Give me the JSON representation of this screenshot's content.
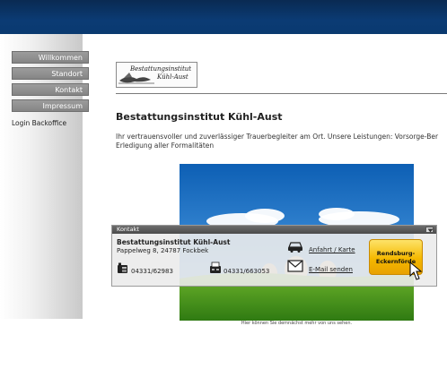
{
  "nav": {
    "items": [
      {
        "label": "Willkommen"
      },
      {
        "label": "Standort"
      },
      {
        "label": "Kontakt"
      },
      {
        "label": "Impressum"
      }
    ],
    "login": "Login Backoffice"
  },
  "logo": {
    "line1": "Bestattungsinstitut",
    "line2": "Kühl-Aust"
  },
  "content": {
    "heading": "Bestattungsinstitut Kühl-Aust",
    "intro_line1": "Ihr vertrauensvoller und zuverlässiger Trauerbegleiter am Ort. Unsere Leistungen: Vorsorge-Ber",
    "intro_line2": "Erledigung aller Formalitäten",
    "caption": "Hier können Sie demnächst mehr von uns sehen."
  },
  "contact": {
    "title": "Kontakt",
    "firm": "Bestattungsinstitut Kühl-Aust",
    "address": "Pappelweg 8, 24787 Fockbek",
    "phone": "04331/62983",
    "fax": "04331/663053",
    "directions_link": "Anfahrt / Karte",
    "email_link": "E-Mail senden",
    "region_line1": "Rendsburg-",
    "region_line2": "Eckernförde",
    "icons": [
      "phone-icon",
      "fax-icon",
      "car-icon",
      "envelope-icon",
      "chevron-down-icon",
      "cursor-hand-icon"
    ]
  },
  "colors": {
    "topbar": "#0b3b74",
    "nav_button": "#8f8f8f",
    "region_button": "#f5b800",
    "popup_header": "#5a5a5a"
  }
}
